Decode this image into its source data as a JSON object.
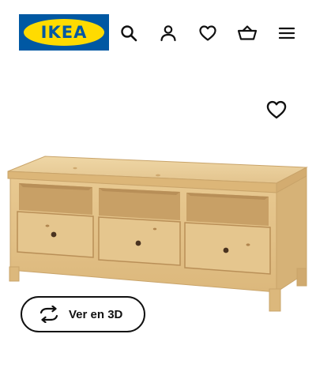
{
  "header": {
    "logo_text": "IKEA",
    "icons": [
      "search-icon",
      "user-icon",
      "heart-icon",
      "basket-icon",
      "menu-icon"
    ]
  },
  "product": {
    "favorite_icon": "heart-icon",
    "image": "wooden-tv-bench"
  },
  "actions": {
    "view_3d_label": "Ver en 3D",
    "view_3d_icon": "rotate-icon"
  },
  "colors": {
    "brand_blue": "#0058a3",
    "brand_yellow": "#ffdb00",
    "wood": "#e6c58f"
  }
}
